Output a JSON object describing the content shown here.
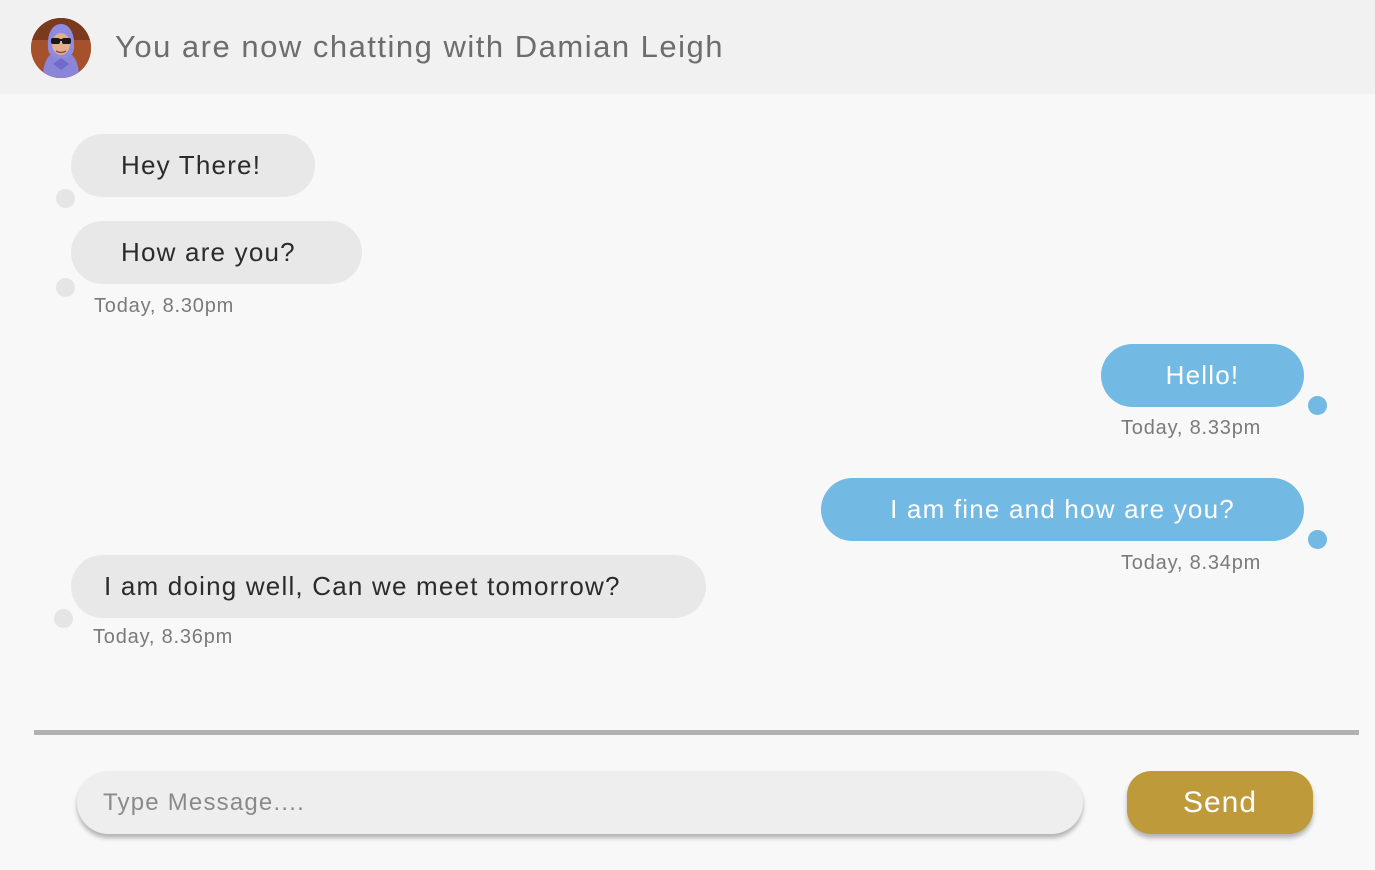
{
  "header": {
    "title": "You are now chatting with Damian Leigh",
    "avatar_icon": "user-avatar-photo"
  },
  "messages": [
    {
      "text": "Hey There!",
      "direction": "incoming"
    },
    {
      "text": "How are you?",
      "direction": "incoming",
      "time": "Today, 8.30pm"
    },
    {
      "text": "Hello!",
      "direction": "outgoing",
      "time": "Today, 8.33pm"
    },
    {
      "text": "I am fine and how are you?",
      "direction": "outgoing",
      "time": "Today, 8.34pm"
    },
    {
      "text": "I am doing well, Can we meet tomorrow?",
      "direction": "incoming",
      "time": "Today, 8.36pm"
    }
  ],
  "composer": {
    "placeholder": "Type Message....",
    "value": "",
    "send_label": "Send"
  },
  "colors": {
    "incoming_bubble": "#e8e8e8",
    "outgoing_bubble": "#72b9e3",
    "send_button": "#bf9a3a",
    "header_bg": "#f1f1f1"
  }
}
